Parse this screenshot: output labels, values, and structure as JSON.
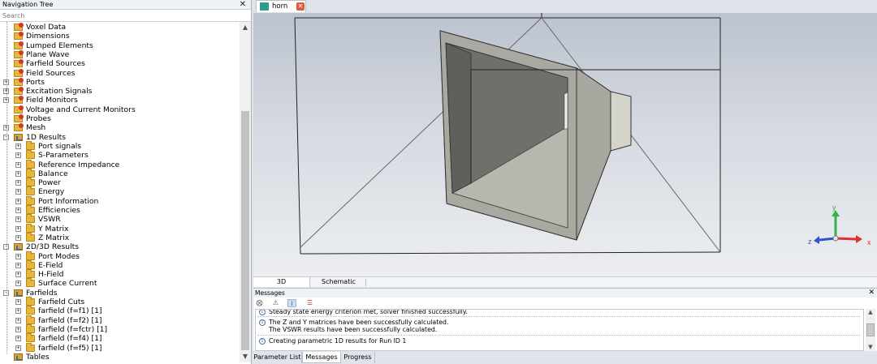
{
  "nav": {
    "title": "Navigation Tree",
    "close": "✕",
    "search_placeholder": "Search",
    "items": [
      {
        "label": "Voxel Data",
        "level": 0,
        "icon": "red",
        "expander": ""
      },
      {
        "label": "Dimensions",
        "level": 0,
        "icon": "red",
        "expander": ""
      },
      {
        "label": "Lumped Elements",
        "level": 0,
        "icon": "red",
        "expander": ""
      },
      {
        "label": "Plane Wave",
        "level": 0,
        "icon": "red",
        "expander": ""
      },
      {
        "label": "Farfield Sources",
        "level": 0,
        "icon": "red",
        "expander": ""
      },
      {
        "label": "Field Sources",
        "level": 0,
        "icon": "red",
        "expander": ""
      },
      {
        "label": "Ports",
        "level": 0,
        "icon": "red",
        "expander": "+"
      },
      {
        "label": "Excitation Signals",
        "level": 0,
        "icon": "red",
        "expander": "+"
      },
      {
        "label": "Field Monitors",
        "level": 0,
        "icon": "red",
        "expander": "+"
      },
      {
        "label": "Voltage and Current Monitors",
        "level": 0,
        "icon": "red",
        "expander": ""
      },
      {
        "label": "Probes",
        "level": 0,
        "icon": "red",
        "expander": ""
      },
      {
        "label": "Mesh",
        "level": 0,
        "icon": "red",
        "expander": "+"
      },
      {
        "label": "1D Results",
        "level": 0,
        "icon": "results",
        "expander": "-"
      },
      {
        "label": "Port signals",
        "level": 1,
        "icon": "folder",
        "expander": "+"
      },
      {
        "label": "S-Parameters",
        "level": 1,
        "icon": "folder",
        "expander": "+"
      },
      {
        "label": "Reference Impedance",
        "level": 1,
        "icon": "folder",
        "expander": "+"
      },
      {
        "label": "Balance",
        "level": 1,
        "icon": "folder",
        "expander": "+"
      },
      {
        "label": "Power",
        "level": 1,
        "icon": "folder",
        "expander": "+"
      },
      {
        "label": "Energy",
        "level": 1,
        "icon": "folder",
        "expander": "+"
      },
      {
        "label": "Port Information",
        "level": 1,
        "icon": "folder",
        "expander": "+"
      },
      {
        "label": "Efficiencies",
        "level": 1,
        "icon": "folder",
        "expander": "+"
      },
      {
        "label": "VSWR",
        "level": 1,
        "icon": "folder",
        "expander": "+"
      },
      {
        "label": "Y Matrix",
        "level": 1,
        "icon": "folder",
        "expander": "+"
      },
      {
        "label": "Z Matrix",
        "level": 1,
        "icon": "folder",
        "expander": "+"
      },
      {
        "label": "2D/3D Results",
        "level": 0,
        "icon": "results",
        "expander": "-"
      },
      {
        "label": "Port Modes",
        "level": 1,
        "icon": "folder",
        "expander": "+"
      },
      {
        "label": "E-Field",
        "level": 1,
        "icon": "folder",
        "expander": "+"
      },
      {
        "label": "H-Field",
        "level": 1,
        "icon": "folder",
        "expander": "+"
      },
      {
        "label": "Surface Current",
        "level": 1,
        "icon": "folder",
        "expander": "+"
      },
      {
        "label": "Farfields",
        "level": 0,
        "icon": "results",
        "expander": "-"
      },
      {
        "label": "Farfield Cuts",
        "level": 1,
        "icon": "folder",
        "expander": "+"
      },
      {
        "label": "farfield (f=f1) [1]",
        "level": 1,
        "icon": "folder",
        "expander": "+"
      },
      {
        "label": "farfield (f=f2) [1]",
        "level": 1,
        "icon": "folder",
        "expander": "+"
      },
      {
        "label": "farfield (f=fctr) [1]",
        "level": 1,
        "icon": "folder",
        "expander": "+"
      },
      {
        "label": "farfield (f=f4) [1]",
        "level": 1,
        "icon": "folder",
        "expander": "+"
      },
      {
        "label": "farfield (f=f5) [1]",
        "level": 1,
        "icon": "folder",
        "expander": "+"
      },
      {
        "label": "Tables",
        "level": 0,
        "icon": "results",
        "expander": ""
      }
    ]
  },
  "doc_tab": {
    "label": "horn",
    "close": "✕"
  },
  "axes": {
    "x": "x",
    "y": "y",
    "z": "z",
    "x_color": "#d8342b",
    "y_color": "#34b24a",
    "z_color": "#2d56c9"
  },
  "view_tabs": {
    "tab_3d": "3D",
    "tab_schematic": "Schematic"
  },
  "messages": {
    "title": "Messages",
    "close": "✕",
    "items": [
      {
        "lines": [
          "Steady state energy criterion met, solver finished successfully."
        ]
      },
      {
        "lines": [
          "The Z and Y matrices have been successfully calculated.",
          "The VSWR results have been successfully calculated."
        ]
      },
      {
        "lines": [
          "Creating parametric 1D results for Run ID 1"
        ]
      }
    ]
  },
  "bottom_tabs": {
    "param": "Parameter List",
    "messages": "Messages",
    "progress": "Progress"
  }
}
